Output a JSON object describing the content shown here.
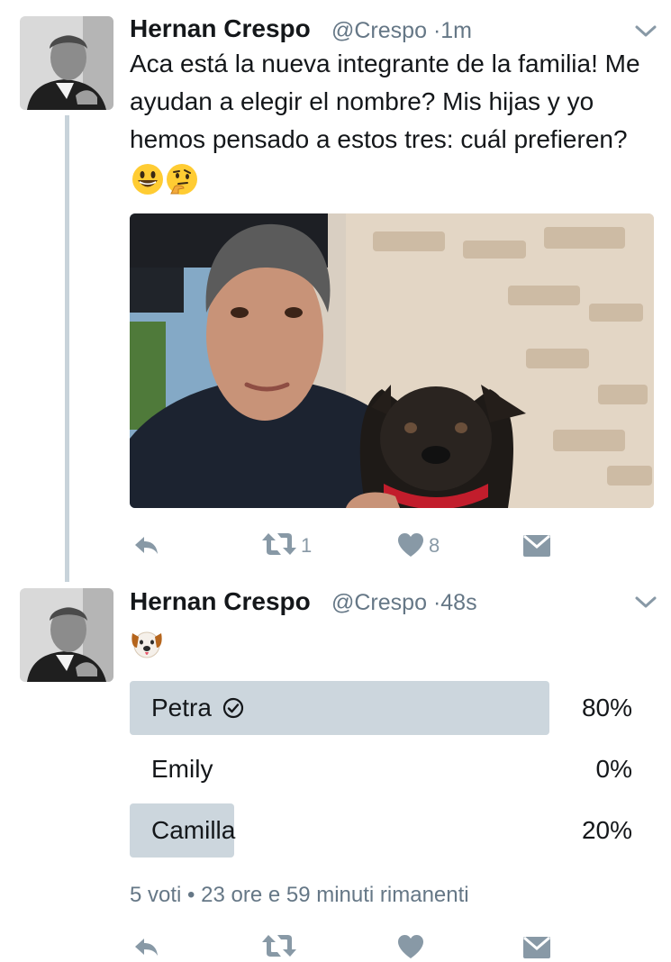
{
  "tweet1": {
    "display_name": "Hernan Crespo",
    "handle": "@Crespo",
    "separator": "·",
    "time": "1m",
    "text": "Aca está la nueva integrante de la familia! Me ayudan a elegir el nombre? Mis hijas y yo hemos pensado a estos tres: cuál prefieren?",
    "emojis": [
      "grinning-face",
      "thinking-face"
    ],
    "actions": {
      "reply_icon": "reply-icon",
      "retweet_icon": "retweet-icon",
      "retweet_count": "1",
      "like_icon": "heart-icon",
      "like_count": "8",
      "dm_icon": "direct-message-icon"
    }
  },
  "tweet2": {
    "display_name": "Hernan Crespo",
    "handle": "@Crespo",
    "separator": "·",
    "time": "48s",
    "emoji": "dog-face",
    "poll": {
      "options": [
        {
          "label": "Petra",
          "percent": "80%",
          "fraction": 0.8,
          "selected": true
        },
        {
          "label": "Emily",
          "percent": "0%",
          "fraction": 0.0,
          "selected": false
        },
        {
          "label": "Camilla",
          "percent": "20%",
          "fraction": 0.2,
          "selected": false
        }
      ],
      "votes": "5 voti",
      "dot": "•",
      "remaining": "23 ore e 59 minuti rimanenti"
    },
    "actions": {
      "reply_icon": "reply-icon",
      "retweet_icon": "retweet-icon",
      "like_icon": "heart-icon",
      "dm_icon": "direct-message-icon"
    }
  },
  "colors": {
    "text": "#14171a",
    "secondary": "#657786",
    "action": "#8899a6",
    "poll_bar": "#ccd6dd",
    "thread_line": "#c8d3da"
  }
}
